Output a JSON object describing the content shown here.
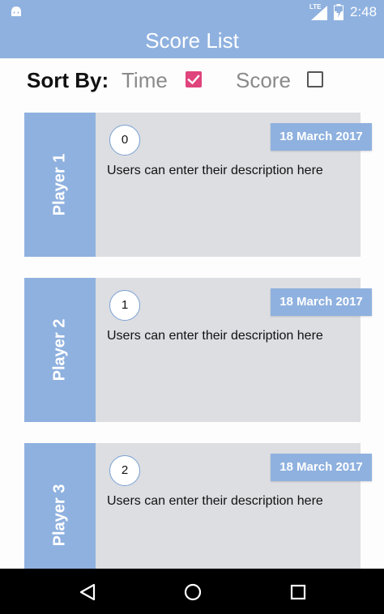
{
  "status_bar": {
    "network": "LTE",
    "time": "2:48",
    "icons": [
      "android-icon",
      "signal-icon",
      "battery-charging-icon"
    ]
  },
  "app_bar": {
    "title": "Score List"
  },
  "sort": {
    "label": "Sort By:",
    "options": [
      {
        "label": "Time",
        "checked": true
      },
      {
        "label": "Score",
        "checked": false
      }
    ],
    "accent_color": "#e0447c"
  },
  "cards": [
    {
      "player": "Player 1",
      "score": "0",
      "date": "18 March 2017",
      "description": "Users can enter their description here"
    },
    {
      "player": "Player 2",
      "score": "1",
      "date": "18 March 2017",
      "description": "Users can enter their description here"
    },
    {
      "player": "Player 3",
      "score": "2",
      "date": "18 March 2017",
      "description": "Users can enter their description here"
    }
  ],
  "nav_bar": {
    "icons": [
      "back-icon",
      "home-icon",
      "recents-icon"
    ]
  },
  "colors": {
    "primary": "#8fb1df",
    "card_background": "#dcdee2",
    "checkbox_checked": "#e0447c"
  }
}
